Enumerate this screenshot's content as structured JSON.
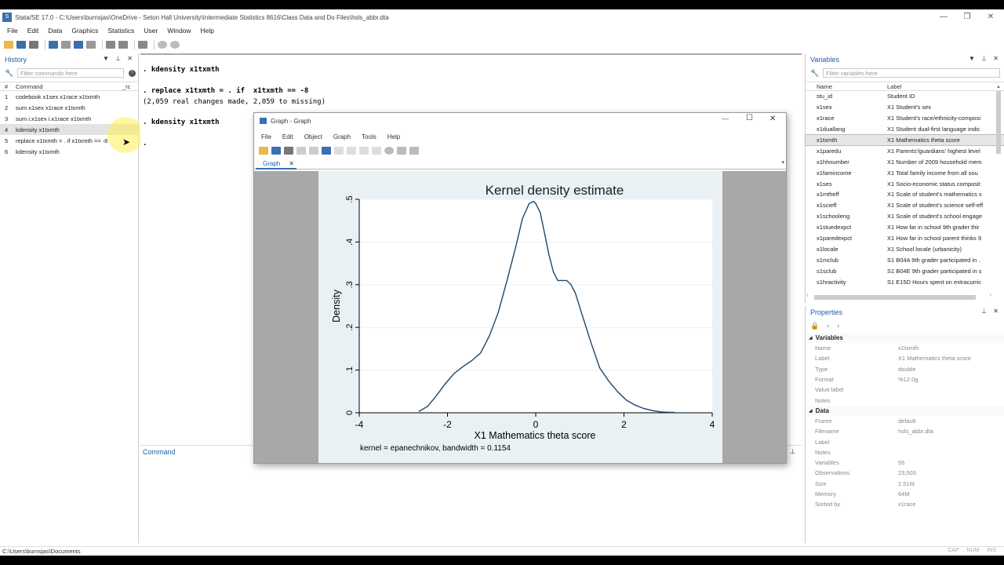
{
  "window": {
    "title": "Stata/SE 17.0 - C:\\Users\\burnsjas\\OneDrive - Seton Hall University\\Intermediate Statistics 8616\\Class Data and Do Files\\hsls_abbr.dta",
    "app_icon": "stata-icon",
    "controls": [
      "minimize-icon",
      "restore-icon",
      "close-icon"
    ]
  },
  "menu": [
    "File",
    "Edit",
    "Data",
    "Graphics",
    "Statistics",
    "User",
    "Window",
    "Help"
  ],
  "history": {
    "title": "History",
    "filter_placeholder": "Filter commands here",
    "col_num": "#",
    "col_command": "Command",
    "col_rc": "_rc",
    "rows": [
      {
        "n": "1",
        "cmd": "codebook x1sex x1race x1txmth"
      },
      {
        "n": "2",
        "cmd": "sum x1sex x1race x1txmth"
      },
      {
        "n": "3",
        "cmd": "sum i.x1sex i.x1race x1txmth"
      },
      {
        "n": "4",
        "cmd": "kdensity x1txmth"
      },
      {
        "n": "5",
        "cmd": "replace x1txmth = . if  x1txmth == -8"
      },
      {
        "n": "6",
        "cmd": "kdensity x1txmth"
      }
    ],
    "selected_index": 3
  },
  "results": {
    "lines": [
      ". kdensity x1txmth",
      ". replace x1txmth = . if  x1txmth == -8",
      "(2,059 real changes made, 2,059 to missing)",
      ". kdensity x1txmth",
      "."
    ]
  },
  "command": {
    "title": "Command"
  },
  "variables": {
    "title": "Variables",
    "filter_placeholder": "Filter variables here",
    "col_name": "Name",
    "col_label": "Label",
    "rows": [
      {
        "name": "stu_id",
        "label": "Student ID"
      },
      {
        "name": "x1sex",
        "label": "X1 Student's sex"
      },
      {
        "name": "x1race",
        "label": "X1 Student's race/ethnicity-composi"
      },
      {
        "name": "x1duallang",
        "label": "X1 Student dual-first language indic"
      },
      {
        "name": "x1txmth",
        "label": "X1 Mathematics theta score"
      },
      {
        "name": "x1paredu",
        "label": "X1 Parents'/guardians' highest level"
      },
      {
        "name": "x1hhnumber",
        "label": "X1 Number of 2009 household mem"
      },
      {
        "name": "x1famincome",
        "label": "X1 Total family income from all sou"
      },
      {
        "name": "x1ses",
        "label": "X1 Socio-economic status composit"
      },
      {
        "name": "x1mtheff",
        "label": "X1 Scale of student's mathematics s"
      },
      {
        "name": "x1scieff",
        "label": "X1 Scale of student's science self-eff"
      },
      {
        "name": "x1schooleng",
        "label": "X1 Scale of student's school engage"
      },
      {
        "name": "x1stuedexpct",
        "label": "X1 How far in school 9th grader thir"
      },
      {
        "name": "x1paredexpct",
        "label": "X1 How far in school parent thinks 9"
      },
      {
        "name": "x1locale",
        "label": "X1 School locale (urbanicity)"
      },
      {
        "name": "s1mclub",
        "label": "S1 B04A 9th grader participated in ."
      },
      {
        "name": "s1sclub",
        "label": "S1 B04E 9th grader participated in s"
      },
      {
        "name": "s1hractivity",
        "label": "S1 E15D Hours spent on extracurric"
      }
    ],
    "selected_index": 4
  },
  "properties": {
    "title": "Properties",
    "sections": [
      {
        "title": "Variables",
        "rows": [
          {
            "k": "Name",
            "v": "x1txmth"
          },
          {
            "k": "Label",
            "v": "X1 Mathematics theta score"
          },
          {
            "k": "Type",
            "v": "double"
          },
          {
            "k": "Format",
            "v": "%12.0g"
          },
          {
            "k": "Value label",
            "v": ""
          },
          {
            "k": "Notes",
            "v": ""
          }
        ]
      },
      {
        "title": "Data",
        "rows": [
          {
            "k": "Frame",
            "v": "default"
          },
          {
            "k": "Filename",
            "v": "hsls_abbr.dta"
          },
          {
            "k": "Label",
            "v": ""
          },
          {
            "k": "Notes",
            "v": ""
          },
          {
            "k": "Variables",
            "v": "55"
          },
          {
            "k": "Observations",
            "v": "23,503"
          },
          {
            "k": "Size",
            "v": "2.51M"
          },
          {
            "k": "Memory",
            "v": "64M"
          },
          {
            "k": "Sorted by",
            "v": "x1race"
          }
        ]
      }
    ]
  },
  "status": {
    "path": "C:\\Users\\burnsjas\\Documents",
    "indicators": "CAP NUM INS"
  },
  "graph_window": {
    "title": "Graph - Graph",
    "menu": [
      "File",
      "Edit",
      "Object",
      "Graph",
      "Tools",
      "Help"
    ],
    "tab": "Graph",
    "tab_close": "✕"
  },
  "chart_data": {
    "type": "line",
    "title": "Kernel density estimate",
    "xlabel": "X1 Mathematics theta score",
    "ylabel": "Density",
    "note": "kernel = epanechnikov, bandwidth = 0.1154",
    "xlim": [
      -4,
      4
    ],
    "ylim": [
      0,
      0.5
    ],
    "xticks": [
      "-4",
      "-2",
      "0",
      "2",
      "4"
    ],
    "xtick_values": [
      -4,
      -2,
      0,
      2,
      4
    ],
    "yticks": [
      "0",
      ".1",
      ".2",
      ".3",
      ".4",
      ".5"
    ],
    "ytick_values": [
      0,
      0.1,
      0.2,
      0.3,
      0.4,
      0.5
    ],
    "grid": true,
    "series": [
      {
        "color": "#1a476f",
        "x": [
          -2.65,
          -2.45,
          -2.25,
          -2.05,
          -1.85,
          -1.65,
          -1.45,
          -1.25,
          -1.05,
          -0.85,
          -0.65,
          -0.45,
          -0.3,
          -0.15,
          -0.05,
          0.0,
          0.1,
          0.2,
          0.3,
          0.4,
          0.5,
          0.6,
          0.7,
          0.8,
          0.9,
          1.05,
          1.25,
          1.45,
          1.65,
          1.85,
          2.05,
          2.25,
          2.45,
          2.65,
          2.85,
          3.05,
          3.15
        ],
        "y": [
          0.003,
          0.015,
          0.04,
          0.068,
          0.092,
          0.108,
          0.122,
          0.14,
          0.18,
          0.235,
          0.31,
          0.39,
          0.455,
          0.49,
          0.495,
          0.49,
          0.47,
          0.42,
          0.37,
          0.33,
          0.31,
          0.31,
          0.31,
          0.3,
          0.28,
          0.23,
          0.165,
          0.105,
          0.075,
          0.05,
          0.03,
          0.018,
          0.01,
          0.005,
          0.002,
          0.001,
          0.001
        ]
      }
    ]
  },
  "colors": {
    "accent": "#1f5ea8",
    "series": "#1a476f",
    "plot_bg": "#eaf1f5",
    "frame_bg": "#a8a8a8"
  }
}
